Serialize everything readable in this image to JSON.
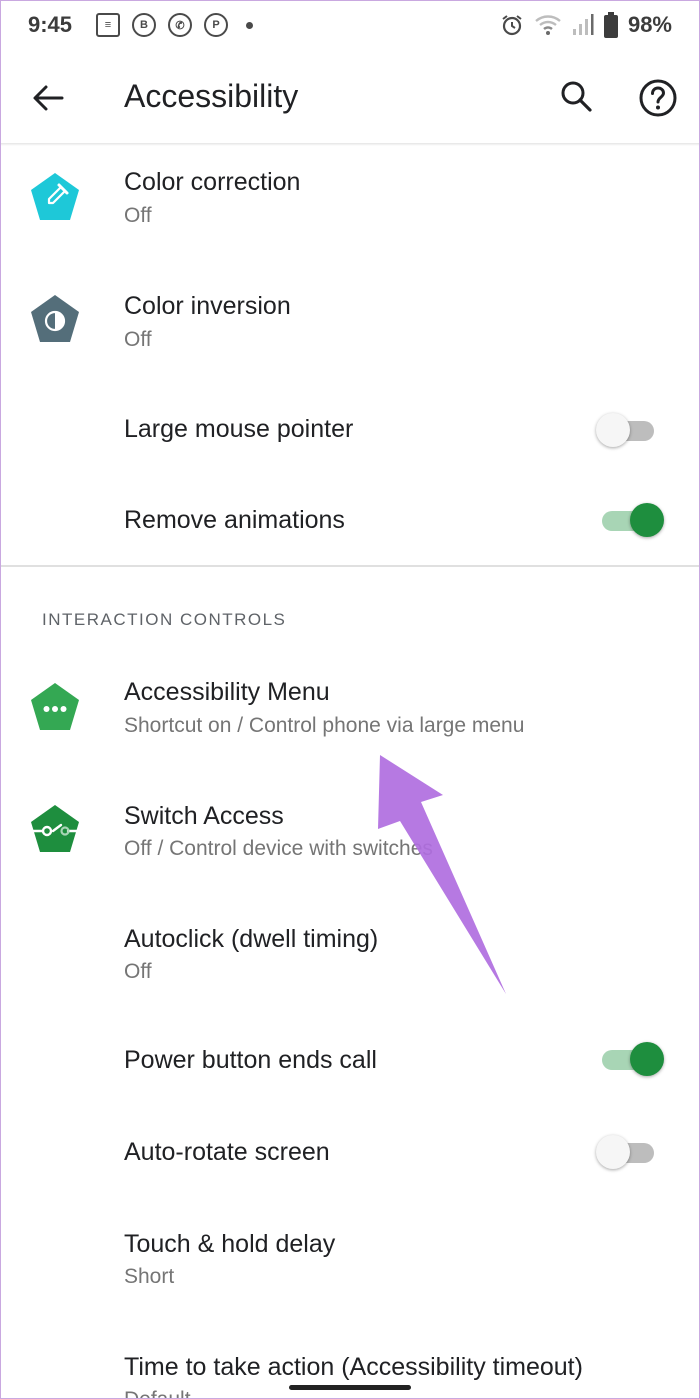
{
  "status_bar": {
    "time": "9:45",
    "left_icons": [
      "news-icon",
      "b-app-icon",
      "whatsapp-icon",
      "pinterest-icon",
      "dot-icon"
    ],
    "right_icons": [
      "alarm-icon",
      "wifi-icon",
      "signal-icon",
      "battery-icon"
    ],
    "battery": "98%"
  },
  "app_bar": {
    "title": "Accessibility",
    "back_icon": "arrow-back-icon",
    "search_icon": "search-icon",
    "help_icon": "help-icon"
  },
  "items": {
    "color_correction": {
      "title": "Color correction",
      "subtitle": "Off",
      "icon": "eyedropper-icon",
      "icon_color": "#1ec8d8"
    },
    "color_inversion": {
      "title": "Color inversion",
      "subtitle": "Off",
      "icon": "invert-colors-icon",
      "icon_color": "#546e7a"
    },
    "large_mouse_pointer": {
      "title": "Large mouse pointer",
      "toggle": false
    },
    "remove_animations": {
      "title": "Remove animations",
      "toggle": true
    }
  },
  "interaction_controls": {
    "header": "INTERACTION CONTROLS",
    "accessibility_menu": {
      "title": "Accessibility Menu",
      "subtitle": "Shortcut on / Control phone via large menu",
      "icon": "menu-dots-icon",
      "icon_color": "#34a853"
    },
    "switch_access": {
      "title": "Switch Access",
      "subtitle": "Off / Control device with switches",
      "icon": "switch-access-icon",
      "icon_color": "#1e8e3e"
    },
    "autoclick": {
      "title": "Autoclick (dwell timing)",
      "subtitle": "Off"
    },
    "power_button_ends_call": {
      "title": "Power button ends call",
      "toggle": true
    },
    "auto_rotate_screen": {
      "title": "Auto-rotate screen",
      "toggle": false
    },
    "touch_hold_delay": {
      "title": "Touch & hold delay",
      "subtitle": "Short"
    },
    "time_to_take_action": {
      "title": "Time to take action (Accessibility timeout)",
      "subtitle": "Default"
    }
  },
  "colors": {
    "accent_green": "#1e8e3e",
    "annotation_arrow": "#b06ee0"
  }
}
